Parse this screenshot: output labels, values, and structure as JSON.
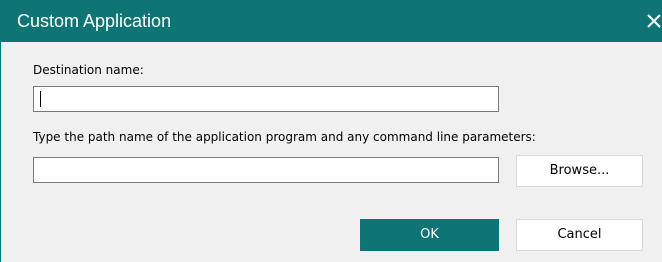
{
  "dialog": {
    "title": "Custom Application",
    "close_icon": "close-icon"
  },
  "destination": {
    "label": "Destination name:",
    "value": ""
  },
  "path": {
    "label": "Type the path name of the application program and any command line parameters:",
    "value": ""
  },
  "buttons": {
    "browse": "Browse...",
    "ok": "OK",
    "cancel": "Cancel"
  },
  "colors": {
    "accent": "#0f7474",
    "background": "#f0f0f0",
    "field_border": "#7a7a7a",
    "button_border": "#d9d9d9"
  }
}
